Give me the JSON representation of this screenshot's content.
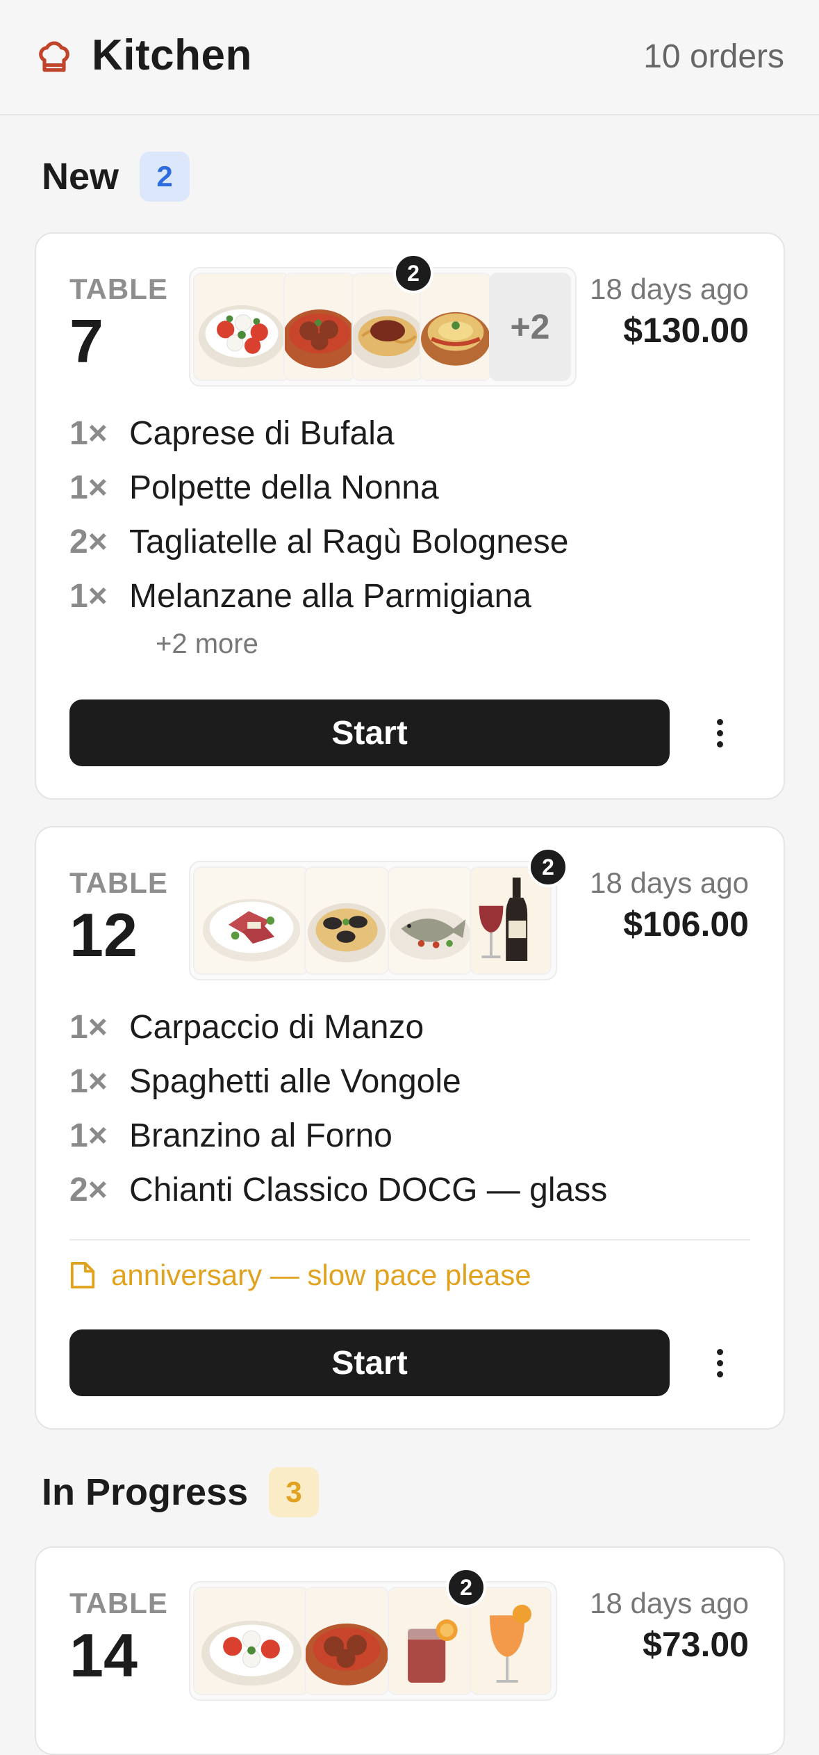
{
  "header": {
    "title": "Kitchen",
    "order_count": "10 orders",
    "icon": "chef-hat-icon",
    "accent": "#c0432a"
  },
  "sections": [
    {
      "label": "New",
      "count": "2",
      "badge_bg": "#dde7fb",
      "badge_fg": "#2d6be0"
    },
    {
      "label": "In Progress",
      "count": "3",
      "badge_bg": "#fbecc8",
      "badge_fg": "#e0a21f"
    }
  ],
  "orders": [
    {
      "table_label": "TABLE",
      "table_number": "7",
      "time": "18 days ago",
      "total": "$130.00",
      "thumb_badge": "2",
      "thumb_more": "+2",
      "thumbs": [
        "caprese-image",
        "polpette-image",
        "tagliatelle-image",
        "parmigiana-image"
      ],
      "items": [
        {
          "qty": "1×",
          "name": "Caprese di Bufala"
        },
        {
          "qty": "1×",
          "name": "Polpette della Nonna"
        },
        {
          "qty": "2×",
          "name": "Tagliatelle al Ragù Bolognese"
        },
        {
          "qty": "1×",
          "name": "Melanzane alla Parmigiana"
        }
      ],
      "more_items": "+2 more",
      "action": "Start"
    },
    {
      "table_label": "TABLE",
      "table_number": "12",
      "time": "18 days ago",
      "total": "$106.00",
      "thumb_badge": "2",
      "thumbs": [
        "carpaccio-image",
        "vongole-image",
        "branzino-image",
        "chianti-image"
      ],
      "items": [
        {
          "qty": "1×",
          "name": "Carpaccio di Manzo"
        },
        {
          "qty": "1×",
          "name": "Spaghetti alle Vongole"
        },
        {
          "qty": "1×",
          "name": "Branzino al Forno"
        },
        {
          "qty": "2×",
          "name": "Chianti Classico DOCG — glass"
        }
      ],
      "note": "anniversary — slow pace please",
      "note_icon": "note-icon",
      "action": "Start"
    },
    {
      "table_label": "TABLE",
      "table_number": "14",
      "time": "18 days ago",
      "total": "$73.00",
      "thumb_badge": "2",
      "thumbs": [
        "caprese-image",
        "polpette-image",
        "negroni-image",
        "spritz-image"
      ]
    }
  ]
}
